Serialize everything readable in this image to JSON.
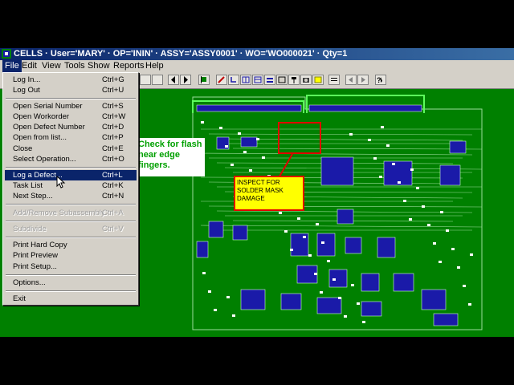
{
  "window": {
    "title": "CELLS · User='MARY' · OP='ININ' · ASSY='ASSY0001' · WO='WO000021' · Qty=1"
  },
  "menubar": [
    {
      "label": "File"
    },
    {
      "label": "Edit"
    },
    {
      "label": "View"
    },
    {
      "label": "Tools"
    },
    {
      "label": "Show"
    },
    {
      "label": "Reports"
    },
    {
      "label": "Help"
    }
  ],
  "file_menu": {
    "items": [
      {
        "label": "Log In...",
        "shortcut": "Ctrl+G"
      },
      {
        "label": "Log Out",
        "shortcut": "Ctrl+U"
      },
      {
        "label": "Open Serial Number",
        "shortcut": "Ctrl+S"
      },
      {
        "label": "Open Workorder",
        "shortcut": "Ctrl+W"
      },
      {
        "label": "Open Defect Number",
        "shortcut": "Ctrl+D"
      },
      {
        "label": "Open from list...",
        "shortcut": "Ctrl+P"
      },
      {
        "label": "Close",
        "shortcut": "Ctrl+E"
      },
      {
        "label": "Select Operation...",
        "shortcut": "Ctrl+O"
      },
      {
        "label": "Log a Defect...",
        "shortcut": "Ctrl+L"
      },
      {
        "label": "Task List",
        "shortcut": "Ctrl+K"
      },
      {
        "label": "Next Step...",
        "shortcut": "Ctrl+N"
      },
      {
        "label": "Add/Remove Subassembly",
        "shortcut": "Ctrl+A"
      },
      {
        "label": "Subdivide",
        "shortcut": "Ctrl+V"
      },
      {
        "label": "Print Hard Copy",
        "shortcut": ""
      },
      {
        "label": "Print Preview",
        "shortcut": ""
      },
      {
        "label": "Print Setup...",
        "shortcut": ""
      },
      {
        "label": "Options...",
        "shortcut": ""
      },
      {
        "label": "Exit",
        "shortcut": ""
      }
    ]
  },
  "callouts": {
    "check": "Check for flash near edge fingers.",
    "inspect": "INSPECT FOR SOLDER MASK DAMAGE"
  },
  "colors": {
    "board": "#008000",
    "traces": "#9cdc9c",
    "components": "#1a1aa8",
    "highlight": "#0a246a",
    "callout_red": "#e00000",
    "callout_yellow": "#ffff00"
  }
}
